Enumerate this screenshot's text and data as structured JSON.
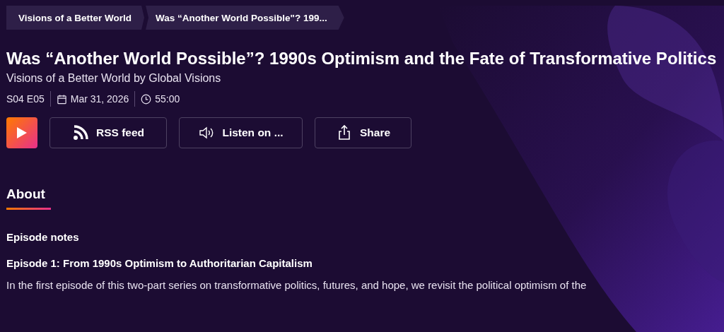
{
  "breadcrumbs": [
    {
      "label": "Visions of a Better World"
    },
    {
      "label": "Was “Another World Possible\"? 199..."
    }
  ],
  "episode": {
    "title": "Was “Another World Possible”? 1990s Optimism and the Fate of Transformative Politics",
    "show": "Visions of a Better World by Global Visions",
    "number": "S04 E05",
    "date": "Mar 31, 2026",
    "duration": "55:00"
  },
  "actions": [
    {
      "kind": "play"
    },
    {
      "kind": "rss",
      "label": "RSS feed"
    },
    {
      "kind": "listen",
      "label": "Listen on ..."
    },
    {
      "kind": "share",
      "label": "Share"
    }
  ],
  "about": {
    "heading": "About",
    "notes_heading": "Episode notes",
    "episode_heading": "Episode 1: From 1990s Optimism to Authoritarian Capitalism",
    "paragraph": "In the first episode of this two-part series on transformative politics, futures, and hope, we revisit the political optimism of the"
  }
}
